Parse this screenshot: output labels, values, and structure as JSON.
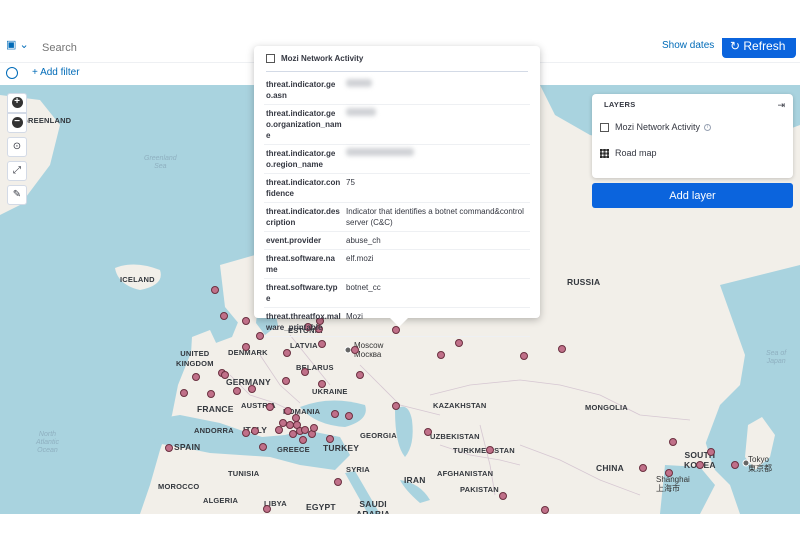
{
  "query_bar": {
    "search_placeholder": "Search",
    "show_dates_label": "Show dates",
    "refresh_label": "Refresh",
    "add_filter_label": "+ Add filter"
  },
  "map_labels": {
    "countries": [
      {
        "text": "GREENLAND"
      },
      {
        "text": "ICELAND"
      },
      {
        "text": "UNITED\nKINGDOM"
      },
      {
        "text": "DENMARK"
      },
      {
        "text": "ESTONIA"
      },
      {
        "text": "LATVIA"
      },
      {
        "text": "BELARUS"
      },
      {
        "text": "UKRAINE"
      },
      {
        "text": "GERMANY"
      },
      {
        "text": "FRANCE"
      },
      {
        "text": "AUSTRIA"
      },
      {
        "text": "ROMANIA"
      },
      {
        "text": "ANDORRA"
      },
      {
        "text": "ITALY"
      },
      {
        "text": "SPAIN"
      },
      {
        "text": "GREECE"
      },
      {
        "text": "TURKEY"
      },
      {
        "text": "GEORGIA"
      },
      {
        "text": "TUNISIA"
      },
      {
        "text": "SYRIA"
      },
      {
        "text": "MOROCCO"
      },
      {
        "text": "ALGERIA"
      },
      {
        "text": "LIBYA"
      },
      {
        "text": "EGYPT"
      },
      {
        "text": "SAUDI\nARABIA"
      },
      {
        "text": "IRAN"
      },
      {
        "text": "AFGHANISTAN"
      },
      {
        "text": "PAKISTAN"
      },
      {
        "text": "KAZAKHSTAN"
      },
      {
        "text": "UZBEKISTAN"
      },
      {
        "text": "TURKMENISTAN"
      },
      {
        "text": "RUSSIA"
      },
      {
        "text": "MONGOLIA"
      },
      {
        "text": "CHINA"
      },
      {
        "text": "SOUTH\nKOREA"
      }
    ],
    "cities": [
      {
        "text": "Moscow\nМосква"
      },
      {
        "text": "Shanghai\n上海市"
      },
      {
        "text": "Tokyo\n東京都"
      }
    ],
    "seas": [
      {
        "text": "Greenland\nSea"
      },
      {
        "text": "North\nAtlantic\nOcean"
      },
      {
        "text": "Sea of\nJapan"
      }
    ]
  },
  "map_points_count": 60,
  "tooltip": {
    "title": "Mozi Network Activity",
    "rows": [
      {
        "key": "threat.indicator.geo.asn",
        "value": "",
        "redacted": true
      },
      {
        "key": "threat.indicator.geo.organization_name",
        "value": "",
        "redacted": true
      },
      {
        "key": "threat.indicator.geo.region_name",
        "value": "",
        "redacted": true
      },
      {
        "key": "threat.indicator.confidence",
        "value": "75",
        "redacted": false
      },
      {
        "key": "threat.indicator.description",
        "value": "Indicator that identifies a botnet command&control server (C&C)",
        "redacted": false
      },
      {
        "key": "event.provider",
        "value": "abuse_ch",
        "redacted": false
      },
      {
        "key": "threat.software.name",
        "value": "elf.mozi",
        "redacted": false
      },
      {
        "key": "threat.software.type",
        "value": "botnet_cc",
        "redacted": false
      },
      {
        "key": "threat.threatfox.malware_printable",
        "value": "Mozi",
        "redacted": false
      }
    ]
  },
  "layers_panel": {
    "title": "LAYERS",
    "layers": [
      {
        "name": "Mozi Network Activity",
        "icon": "vector-layer-icon"
      },
      {
        "name": "Road map",
        "icon": "tile-layer-icon"
      }
    ],
    "add_layer_label": "Add layer"
  },
  "colors": {
    "primary": "#0b64dd",
    "point_fill": "#c07089",
    "land": "#f2efe9",
    "water": "#a9d3df"
  }
}
